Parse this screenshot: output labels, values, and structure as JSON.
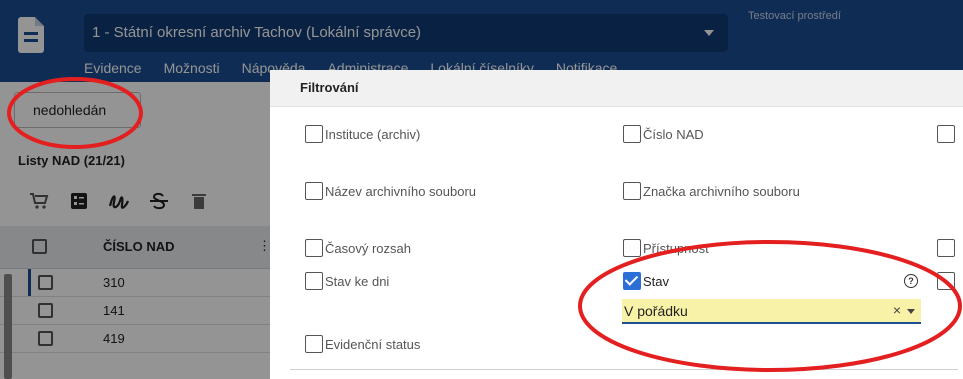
{
  "header": {
    "archive": "1 - Státní okresní archiv Tachov  (Lokální správce)",
    "environment": "Testovací prostředí",
    "menu": [
      "Evidence",
      "Možnosti",
      "Nápověda",
      "Administrace",
      "Lokální číselníky",
      "Notifikace"
    ]
  },
  "search": {
    "value": "nedohledán"
  },
  "list": {
    "title": "Listy NAD (21/21)",
    "column_header": "ČÍSLO NAD",
    "rows": [
      "310",
      "141",
      "419"
    ]
  },
  "filter_dialog": {
    "title": "Filtrování",
    "fields": {
      "instituce": "Instituce (archiv)",
      "cislo_nad": "Číslo NAD",
      "nazev": "Název archivního souboru",
      "znacka": "Značka archivního souboru",
      "casovy_rozsah": "Časový rozsah",
      "pristupnost": "Přístupnost",
      "stav_ke_dni": "Stav ke dni",
      "stav": "Stav",
      "evidencni_status": "Evidenční status"
    },
    "stav_value": "V pořádku",
    "clear_symbol": "×",
    "help_symbol": "?"
  },
  "icons": {
    "toolbar": [
      "cart-icon",
      "list-icon",
      "signature-icon",
      "strikethrough-icon",
      "trash-icon"
    ]
  },
  "colors": {
    "header": "#1b4f91",
    "highlight": "#f7f2a8",
    "annotation": "#e41f1f",
    "checked": "#2b6fd6"
  }
}
